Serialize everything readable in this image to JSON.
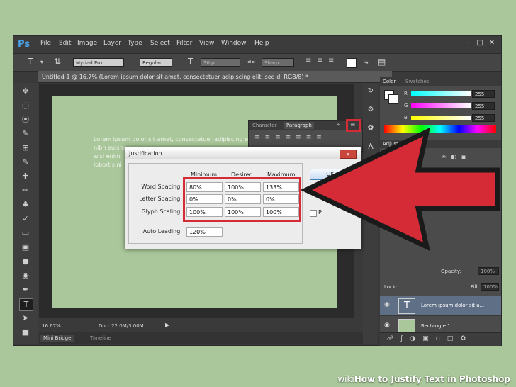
{
  "app": {
    "logo": "Ps"
  },
  "menu": [
    "File",
    "Edit",
    "Image",
    "Layer",
    "Type",
    "Select",
    "Filter",
    "View",
    "Window",
    "Help"
  ],
  "options_bar": {
    "tool_glyph": "T",
    "font_family": "Myriad Pro",
    "font_style": "Regular",
    "font_size": "30 pt",
    "antialias": "Sharp"
  },
  "document": {
    "tab_title": "Untitled-1 @ 16.7% (Lorem ipsum dolor sit amet, consectetuer adipiscing elit, sed d, RGB/8) *",
    "canvas_text": [
      "Lorem ipsum dolor sit amet, consectetuer adipiscing elit,",
      "nibh euism",
      "wisi enim",
      "lobortis ni"
    ],
    "zoom": "16.67%",
    "doc_size": "Doc: 22.0M/3.00M"
  },
  "bottom_tabs": [
    "Mini Bridge",
    "Timeline"
  ],
  "color_panel": {
    "tabs": [
      "Color",
      "Swatches"
    ],
    "channels": [
      {
        "label": "R",
        "value": "255"
      },
      {
        "label": "G",
        "value": "255"
      },
      {
        "label": "B",
        "value": "255"
      }
    ]
  },
  "adjustments": {
    "title": "Adjustm"
  },
  "layers_panel": {
    "opacity_label": "Opacity:",
    "opacity_value": "100%",
    "lock_label": "Lock:",
    "fill_label": "Fill:",
    "fill_value": "100%",
    "layers": [
      {
        "name": "Lorem ipsum dolor sit a...",
        "type": "text"
      },
      {
        "name": "Rectangle 1",
        "type": "shape"
      }
    ]
  },
  "char_panel": {
    "tabs": [
      "Character",
      "Paragraph"
    ]
  },
  "justification_dialog": {
    "title": "Justification",
    "close": "x",
    "columns": [
      "Minimum",
      "Desired",
      "Maximum"
    ],
    "rows": [
      {
        "label": "Word Spacing:",
        "min": "80%",
        "desired": "100%",
        "max": "133%"
      },
      {
        "label": "Letter Spacing:",
        "min": "0%",
        "desired": "0%",
        "max": "0%"
      },
      {
        "label": "Glyph Scaling:",
        "min": "100%",
        "desired": "100%",
        "max": "100%"
      }
    ],
    "auto_leading_label": "Auto Leading:",
    "auto_leading_value": "120%",
    "ok_label": "OK",
    "preview_label": "P"
  },
  "watermark": {
    "brand": "wiki",
    "title": "How to Justify Text in Photoshop"
  },
  "colors": {
    "highlight": "#d42b36",
    "arrow": "#d42b36",
    "ps_blue": "#4aa3e8"
  }
}
